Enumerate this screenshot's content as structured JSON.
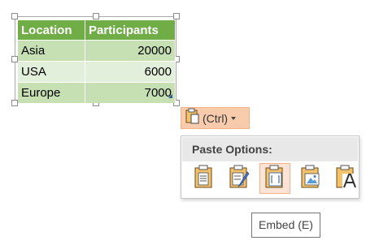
{
  "table": {
    "headers": [
      "Location",
      "Participants"
    ],
    "rows": [
      [
        "Asia",
        "20000"
      ],
      [
        "USA",
        "6000"
      ],
      [
        "Europe",
        "7000"
      ]
    ]
  },
  "paste_button": {
    "label": "(Ctrl)",
    "icon": "clipboard-icon"
  },
  "paste_options": {
    "title": "Paste Options:",
    "options": [
      {
        "icon": "keep-source-formatting-icon"
      },
      {
        "icon": "use-destination-styles-icon"
      },
      {
        "icon": "embed-icon",
        "selected": true
      },
      {
        "icon": "picture-icon"
      },
      {
        "icon": "keep-text-only-icon"
      }
    ]
  },
  "tooltip": {
    "text": "Embed (E)"
  },
  "colors": {
    "header": "#70ad47",
    "row_dark": "#c6e0b4",
    "row_light": "#e2efda",
    "accent": "#f8cbad"
  }
}
